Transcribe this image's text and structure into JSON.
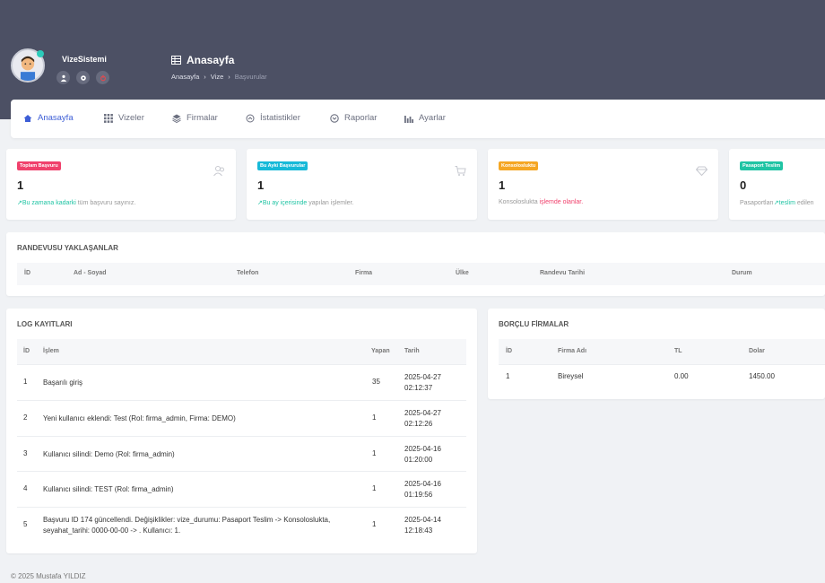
{
  "user": {
    "name": "VizeSistemi"
  },
  "header": {
    "title": "Anasayfa",
    "breadcrumb": [
      "Anasayfa",
      "Vize",
      "Başvurular"
    ]
  },
  "nav": [
    "Anasayfa",
    "Vizeler",
    "Firmalar",
    "İstatistikler",
    "Raporlar",
    "Ayarlar"
  ],
  "stats": [
    {
      "badge": "Toplam Başvuru",
      "value": "1",
      "desc_hl": "Bu zamana kadarki",
      "desc": " tüm başvuru sayınız.",
      "color": "#f0416c",
      "hl_color": "#20c4a4",
      "icon": "users-icon"
    },
    {
      "badge": "Bu Ayki Başvurular",
      "value": "1",
      "desc_hl": "Bu ay içerisinde",
      "desc": " yapılan işlemler.",
      "color": "#17b9d8",
      "hl_color": "#20c4a4",
      "icon": "cart-icon"
    },
    {
      "badge": "Konsolosluktu",
      "value": "1",
      "desc_pre": "Konsoloslukta ",
      "desc_hl": "işlemde olanlar.",
      "color": "#f5a623",
      "hl_color": "#f0416c",
      "icon": "diamond-icon"
    },
    {
      "badge": "Pasaport Teslim",
      "value": "0",
      "desc_pre": "Pasaportları",
      "desc_hl": "teslim",
      "desc": " edilen",
      "color": "#20c4a4",
      "hl_color": "#20c4a4",
      "icon": "heart-icon"
    }
  ],
  "appointments": {
    "title": "RANDEVUSU YAKLAŞANLAR",
    "headers": [
      "İD",
      "Ad - Soyad",
      "Telefon",
      "Firma",
      "Ülke",
      "Randevu Tarihi",
      "Durum"
    ]
  },
  "logs": {
    "title": "LOG KAYITLARI",
    "headers": [
      "İD",
      "İşlem",
      "Yapan",
      "Tarih"
    ],
    "rows": [
      {
        "id": "1",
        "action": "Başarılı giriş",
        "action2": "",
        "by": "35",
        "date": "2025-04-27",
        "time": "02:12:37"
      },
      {
        "id": "2",
        "action": "Yeni kullanıcı eklendi: Test (Rol: firma_admin, Firma: DEMO)",
        "action2": "",
        "by": "1",
        "date": "2025-04-27",
        "time": "02:12:26"
      },
      {
        "id": "3",
        "action": "Kullanıcı silindi: Demo (Rol: firma_admin)",
        "action2": "",
        "by": "1",
        "date": "2025-04-16",
        "time": "01:20:00"
      },
      {
        "id": "4",
        "action": "Kullanıcı silindi: TEST (Rol: firma_admin)",
        "action2": "",
        "by": "1",
        "date": "2025-04-16",
        "time": "01:19:56"
      },
      {
        "id": "5",
        "action": "Başvuru ID 174 güncellendi. Değişiklikler: vize_durumu: Pasaport Teslim -> Konsoloslukta,",
        "action2": "seyahat_tarihi: 0000-00-00 -> . Kullanıcı: 1.",
        "by": "1",
        "date": "2025-04-14",
        "time": "12:18:43"
      }
    ]
  },
  "debts": {
    "title": "BORÇLU FİRMALAR",
    "headers": [
      "İD",
      "Firma Adı",
      "TL",
      "Dolar"
    ],
    "rows": [
      {
        "id": "1",
        "name": "Bireysel",
        "tl": "0.00",
        "usd": "1450.00"
      }
    ]
  },
  "footer": "© 2025 Mustafa YILDIZ"
}
